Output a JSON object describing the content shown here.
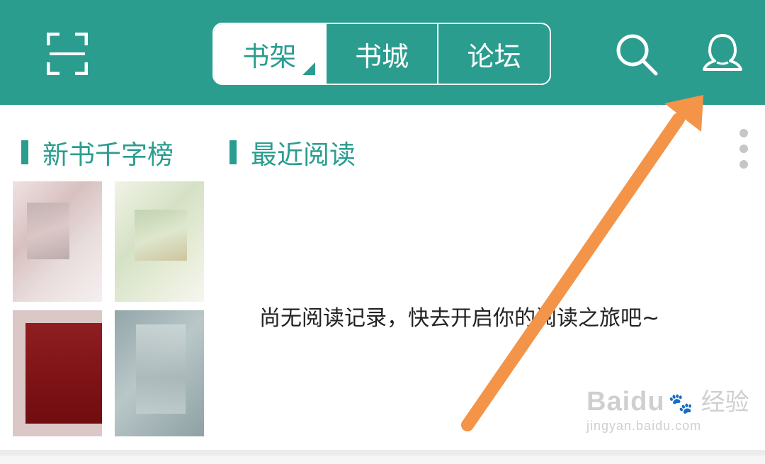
{
  "header": {
    "tabs": [
      {
        "label": "书架",
        "active": true
      },
      {
        "label": "书城",
        "active": false
      },
      {
        "label": "论坛",
        "active": false
      }
    ],
    "icons": {
      "left": "scan-icon",
      "search": "search-icon",
      "profile": "user-icon"
    }
  },
  "sections": {
    "new_books": "新书千字榜",
    "recent": "最近阅读"
  },
  "empty_message": "尚无阅读记录，快去开启你的阅读之旅吧~",
  "annotation": {
    "arrow_color": "#f39449",
    "points_to": "user-icon"
  },
  "watermark": {
    "main": "Baidu",
    "paw": "🐾",
    "cn": "经验",
    "url": "jingyan.baidu.com"
  },
  "colors": {
    "brand": "#2a9d8f",
    "panel": "#ffffff",
    "text": "#222222"
  }
}
